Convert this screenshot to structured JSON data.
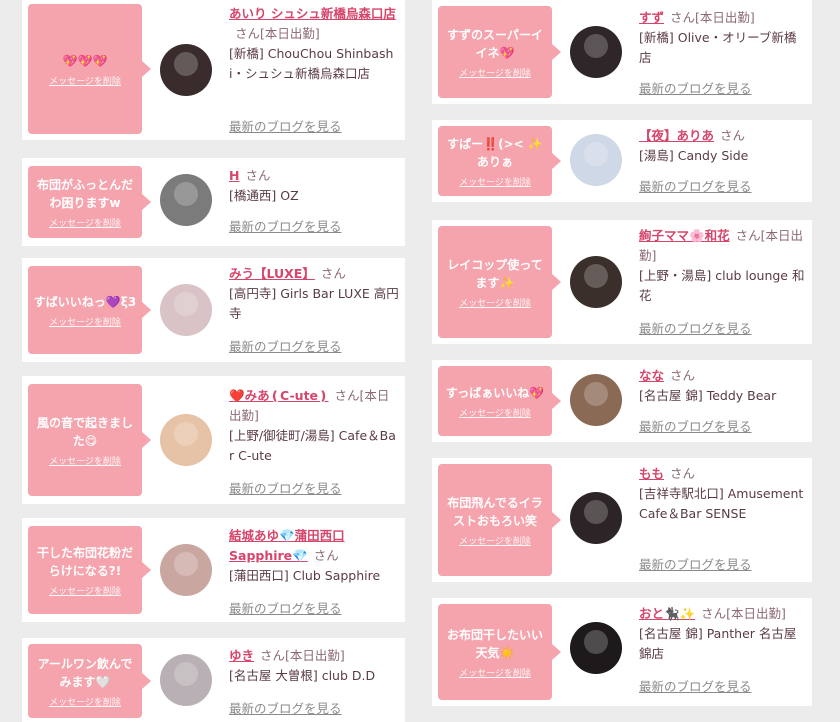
{
  "left": [
    {
      "message": "💖💖💖",
      "delete_label": "メッセージを削除",
      "name": "あいり シュシュ新橋烏森口店",
      "san": "さん[本日出勤]",
      "shop": "[新橋] ChouChou Shinbashi・シュシュ新橋烏森口店",
      "blog": "最新のブログを見る",
      "avatar_color": "#3a2c2c"
    },
    {
      "message": "布団がふっとんだわ困りますw",
      "delete_label": "メッセージを削除",
      "name": "H",
      "san": "さん",
      "shop": "[橋通西] OZ",
      "blog": "最新のブログを見る",
      "avatar_color": "#7b7b7b"
    },
    {
      "message": "すばいいねっ💜ξ3",
      "delete_label": "メッセージを削除",
      "name": "みう【LUXE】",
      "san": "さん",
      "shop": "[高円寺] Girls Bar LUXE 高円寺",
      "blog": "最新のブログを見る",
      "avatar_color": "#d9c3c6"
    },
    {
      "message": "風の音で起きました😋",
      "delete_label": "メッセージを削除",
      "name": "❤️みあ❪C-ute❫",
      "san": "さん[本日出勤]",
      "shop": "[上野/御徒町/湯島] Cafe＆Bar C-ute",
      "blog": "最新のブログを見る",
      "avatar_color": "#e6c2a6"
    },
    {
      "message": "干した布団花粉だらけになる?!",
      "delete_label": "メッセージを削除",
      "name": "結城あゆ💎蒲田西口Sapphire💎",
      "san": "さん",
      "shop": "[蒲田西口] Club Sapphire",
      "blog": "最新のブログを見る",
      "avatar_color": "#c9a7a0"
    },
    {
      "message": "アールワン飲んでみます🤍",
      "delete_label": "メッセージを削除",
      "name": "ゆき",
      "san": "さん[本日出勤]",
      "shop": "[名古屋 大曽根] club D.D",
      "blog": "最新のブログを見る",
      "avatar_color": "#b8b0b4"
    }
  ],
  "right": [
    {
      "message": "すずのスーパーイイネ💖",
      "delete_label": "メッセージを削除",
      "name": "すず",
      "san": "さん[本日出勤]",
      "shop": "[新橋] Olive・オリーブ新橋店",
      "blog": "最新のブログを見る",
      "avatar_color": "#2e2629"
    },
    {
      "message": "すぱー‼️(>< ✨ありぁ",
      "delete_label": "メッセージを削除",
      "name": "【夜】ありあ",
      "san": "さん",
      "shop": "[湯島] Candy Side",
      "blog": "最新のブログを見る",
      "avatar_color": "#cfd8e6"
    },
    {
      "message": "レイコップ使ってます✨",
      "delete_label": "メッセージを削除",
      "name": "絢子ママ🌸和花",
      "san": "さん[本日出勤]",
      "shop": "[上野・湯島] club lounge 和花",
      "blog": "最新のブログを見る",
      "avatar_color": "#3b2f2b"
    },
    {
      "message": "すっばぁいいね💖",
      "delete_label": "メッセージを削除",
      "name": "なな",
      "san": "さん",
      "shop": "[名古屋 錦] Teddy Bear",
      "blog": "最新のブログを見る",
      "avatar_color": "#8a6a55"
    },
    {
      "message": "布団飛んでるイラストおもろい笑",
      "delete_label": "メッセージを削除",
      "name": "もも",
      "san": "さん",
      "shop": "[吉祥寺駅北口] Amusement Cafe＆Bar SENSE",
      "blog": "最新のブログを見る",
      "avatar_color": "#2c2426"
    },
    {
      "message": "お布団干したいい天気☀️",
      "delete_label": "メッセージを削除",
      "name": "おと🐈‍⬛✨",
      "san": "さん[本日出勤]",
      "shop": "[名古屋 錦] Panther 名古屋錦店",
      "blog": "最新のブログを見る",
      "avatar_color": "#1e1a1c"
    }
  ]
}
